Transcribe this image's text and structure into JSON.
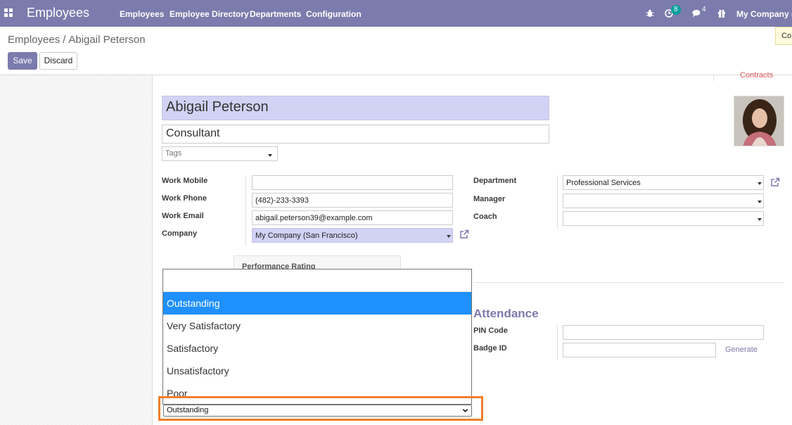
{
  "navbar": {
    "app_title": "Employees",
    "menu": [
      "Employees",
      "Employee Directory",
      "Departments",
      "Configuration"
    ],
    "activity_count": "8",
    "message_count": "4",
    "company": "My Company (S"
  },
  "breadcrumb": {
    "parent": "Employees",
    "separator": "/",
    "current": "Abigail Peterson"
  },
  "buttons": {
    "save": "Save",
    "discard": "Discard"
  },
  "tooltip_text": "Co",
  "stat_button": "Contracts",
  "employee": {
    "name": "Abigail Peterson",
    "job_title": "Consultant",
    "tags_placeholder": "Tags"
  },
  "contact": {
    "work_mobile": {
      "label": "Work Mobile",
      "value": ""
    },
    "work_phone": {
      "label": "Work Phone",
      "value": "(482)-233-3393"
    },
    "work_email": {
      "label": "Work Email",
      "value": "abigail.peterson39@example.com"
    },
    "company": {
      "label": "Company",
      "value": "My Company (San Francisco)"
    }
  },
  "org": {
    "department": {
      "label": "Department",
      "value": "Professional Services"
    },
    "manager": {
      "label": "Manager",
      "value": ""
    },
    "coach": {
      "label": "Coach",
      "value": ""
    }
  },
  "attendance": {
    "title": "Attendance",
    "pin_code": {
      "label": "PIN Code",
      "value": ""
    },
    "badge_id": {
      "label": "Badge ID",
      "value": ""
    },
    "generate": "Generate"
  },
  "performance": {
    "tab_label": "Performance Rating",
    "selected": "Outstanding",
    "options": [
      "Outstanding",
      "Very Satisfactory",
      "Satisfactory",
      "Unsatisfactory",
      "Poor"
    ]
  },
  "colors": {
    "navbar": "#7c7bad",
    "required_field": "#d2d2f5",
    "selected_option": "#1e90ff",
    "highlight": "#f07f2a"
  }
}
